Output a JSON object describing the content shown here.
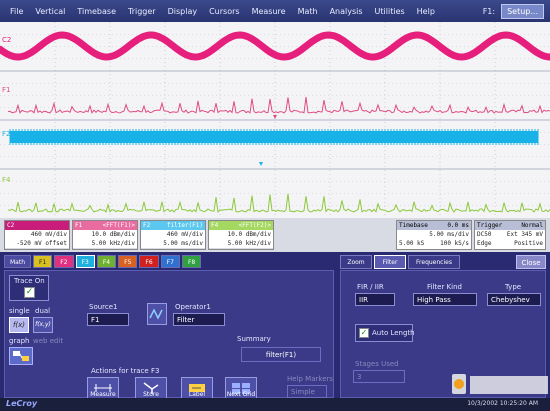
{
  "menu": {
    "items": [
      "File",
      "Vertical",
      "Timebase",
      "Trigger",
      "Display",
      "Cursors",
      "Measure",
      "Math",
      "Analysis",
      "Utilities",
      "Help"
    ],
    "f1_label": "F1:",
    "setup_label": "Setup..."
  },
  "traces": {
    "c2_label": "C2",
    "f1_label": "F1",
    "f2_label": "F2",
    "f4_label": "F4"
  },
  "colors": {
    "c2": "#e61e7c",
    "f1": "#e04c80",
    "f2": "#19b2e8",
    "f4": "#8cc83c"
  },
  "trace_boxes": [
    {
      "name": "C2",
      "extra": "",
      "row1": "460 mV/div",
      "row2": "-520 mV offset",
      "color": "#c81d7a"
    },
    {
      "name": "F1",
      "extra": "<FFT(F1)>",
      "row1": "10.0 dBm/div",
      "row2": "5.00 kHz/div",
      "color": "#e86ca0"
    },
    {
      "name": "F2",
      "extra": "filter(F1)",
      "row1": "460 mV/div",
      "row2": "5.00 ms/div",
      "color": "#5cc8f0"
    },
    {
      "name": "F4",
      "extra": "<FFT(F2)>",
      "row1": "10.0 dBm/div",
      "row2": "5.00 kHz/div",
      "color": "#a4d860"
    }
  ],
  "timebase": {
    "title": "Timebase",
    "value": "0.0 ms",
    "row1": "5.00 ms/div",
    "row2_left": "5.00 kS",
    "row2_right": "100 kS/s"
  },
  "trigger": {
    "title": "Trigger",
    "mode": "Normal",
    "row1_left": "DC50",
    "row1_right": "Ext 345 mV",
    "row2_left": "Edge",
    "row2_right": "Positive"
  },
  "left_tabs": [
    {
      "label": "Math",
      "color": "#4a4aa0"
    },
    {
      "label": "F1",
      "color": "#d8c020"
    },
    {
      "label": "F2",
      "color": "#e03080"
    },
    {
      "label": "F3",
      "color": "#20b0e0"
    },
    {
      "label": "F4",
      "color": "#70b030"
    },
    {
      "label": "F5",
      "color": "#d86020"
    },
    {
      "label": "F6",
      "color": "#d02020"
    },
    {
      "label": "F7",
      "color": "#3070d0"
    },
    {
      "label": "F8",
      "color": "#30a040"
    }
  ],
  "panel": {
    "trace_on": "Trace On",
    "single": "single",
    "dual": "dual",
    "graph": "graph",
    "web_edit": "web edit",
    "source_label": "Source1",
    "source_value": "F1",
    "operator_label": "Operator1",
    "operator_value": "Filter",
    "summary_label": "Summary",
    "summary_value": "filter(F1)",
    "actions_label": "Actions for trace F3",
    "buttons": [
      "Measure",
      "Store",
      "Label",
      "Next Grid"
    ],
    "help_markers": "Help Markers",
    "simple": "Simple"
  },
  "right_panel": {
    "tabs": [
      "Zoom",
      "Filter",
      "Frequencies"
    ],
    "close": "Close",
    "fir_iir_label": "FIR / IIR",
    "fir_iir_value": "IIR",
    "filter_kind_label": "Filter Kind",
    "filter_kind_value": "High Pass",
    "type_label": "Type",
    "type_value": "Chebyshev",
    "auto_length": "Auto Length",
    "stages_label": "Stages Used",
    "stages_value": "3"
  },
  "status": {
    "logo": "LeCroy",
    "datetime": "10/3/2002 10:25:20 AM"
  }
}
